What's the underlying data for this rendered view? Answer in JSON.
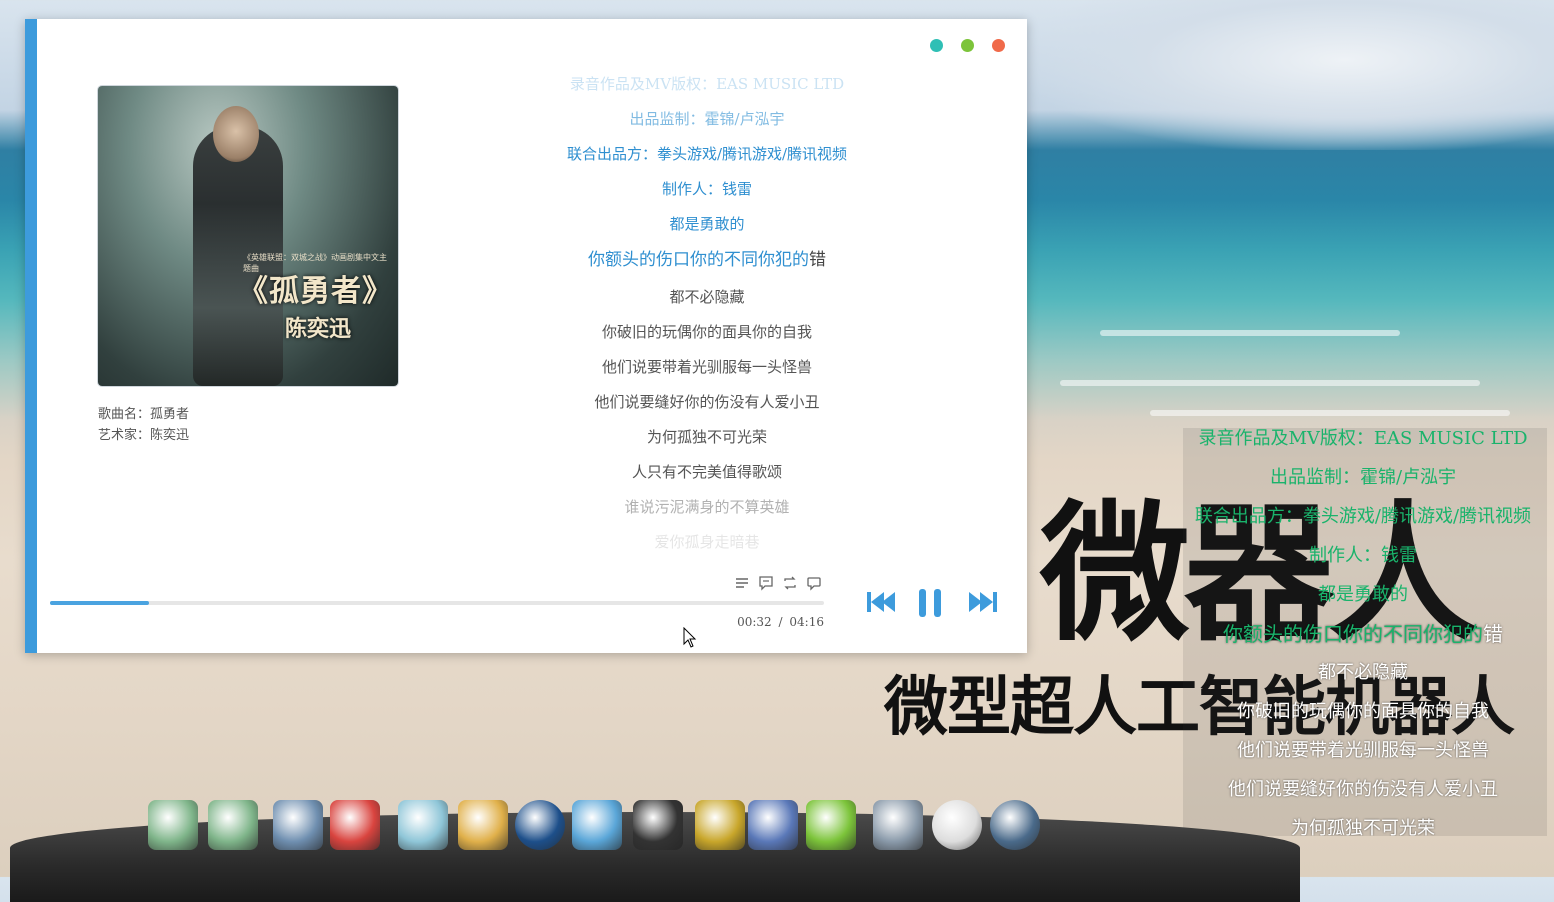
{
  "player": {
    "song_label": "歌曲名：孤勇者",
    "artist_label": "艺术家：陈奕迅",
    "cover": {
      "title": "《孤勇者》",
      "artist": "陈奕迅",
      "small": "《英雄联盟：双城之战》动画剧集中文主题曲"
    },
    "time_current": "00:32",
    "time_sep": "/",
    "time_total": "04:16",
    "progress_fraction": 0.128,
    "lyrics": [
      {
        "text": "录音作品及MV版权：EAS MUSIC LTD",
        "state": "done"
      },
      {
        "text": "出品监制：霍锦/卢泓宇",
        "state": "done"
      },
      {
        "text": "联合出品方：拳头游戏/腾讯游戏/腾讯视频",
        "state": "done"
      },
      {
        "text": "制作人：钱雷",
        "state": "done"
      },
      {
        "text": "都是勇敢的",
        "state": "done"
      },
      {
        "text_hl": "你额头的伤口你的不同你犯的",
        "text_rest": "错",
        "state": "current"
      },
      {
        "text": "都不必隐藏",
        "state": "todo"
      },
      {
        "text": "你破旧的玩偶你的面具你的自我",
        "state": "todo"
      },
      {
        "text": "他们说要带着光驯服每一头怪兽",
        "state": "todo"
      },
      {
        "text": "他们说要缝好你的伤没有人爱小丑",
        "state": "todo"
      },
      {
        "text": "为何孤独不可光荣",
        "state": "todo"
      },
      {
        "text": "人只有不完美值得歌颂",
        "state": "todo"
      },
      {
        "text": "谁说污泥满身的不算英雄",
        "state": "todo"
      },
      {
        "text": "爱你孤身走暗巷",
        "state": "todo"
      }
    ]
  },
  "desktop": {
    "title": "微器人",
    "subtitle": "微型超人工智能机器人",
    "lyrics": [
      {
        "text": "录音作品及MV版权：EAS MUSIC LTD",
        "state": "done"
      },
      {
        "text": "出品监制：霍锦/卢泓宇",
        "state": "done"
      },
      {
        "text": "联合出品方：拳头游戏/腾讯游戏/腾讯视频",
        "state": "done"
      },
      {
        "text": "制作人：钱雷",
        "state": "done"
      },
      {
        "text": "都是勇敢的",
        "state": "done"
      },
      {
        "text_hl": "你额头的伤口你的不同你犯的",
        "text_rest": "错",
        "state": "current"
      },
      {
        "text": "都不必隐藏",
        "state": "todo"
      },
      {
        "text": "你破旧的玩偶你的面具你的自我",
        "state": "todo"
      },
      {
        "text": "他们说要带着光驯服每一头怪兽",
        "state": "todo"
      },
      {
        "text": "他们说要缝好你的伤没有人爱小丑",
        "state": "todo"
      },
      {
        "text": "为何孤独不可光荣",
        "state": "todo"
      }
    ],
    "dock_icons": [
      "folder-icon",
      "folder-icon",
      "computer-icon",
      "rabbit-app-icon",
      "notepad-icon",
      "paint-icon",
      "media-player-icon",
      "network-icon",
      "penguin-icon",
      "contacts-book-icon",
      "presentation-icon",
      "help-icon",
      "drive-icon",
      "settings-sun-icon",
      "globe-icon"
    ]
  },
  "colors": {
    "accent": "#3d9bdc",
    "lyric_done": "#2f8fd0",
    "desk_lyric_done": "#19b36b"
  }
}
